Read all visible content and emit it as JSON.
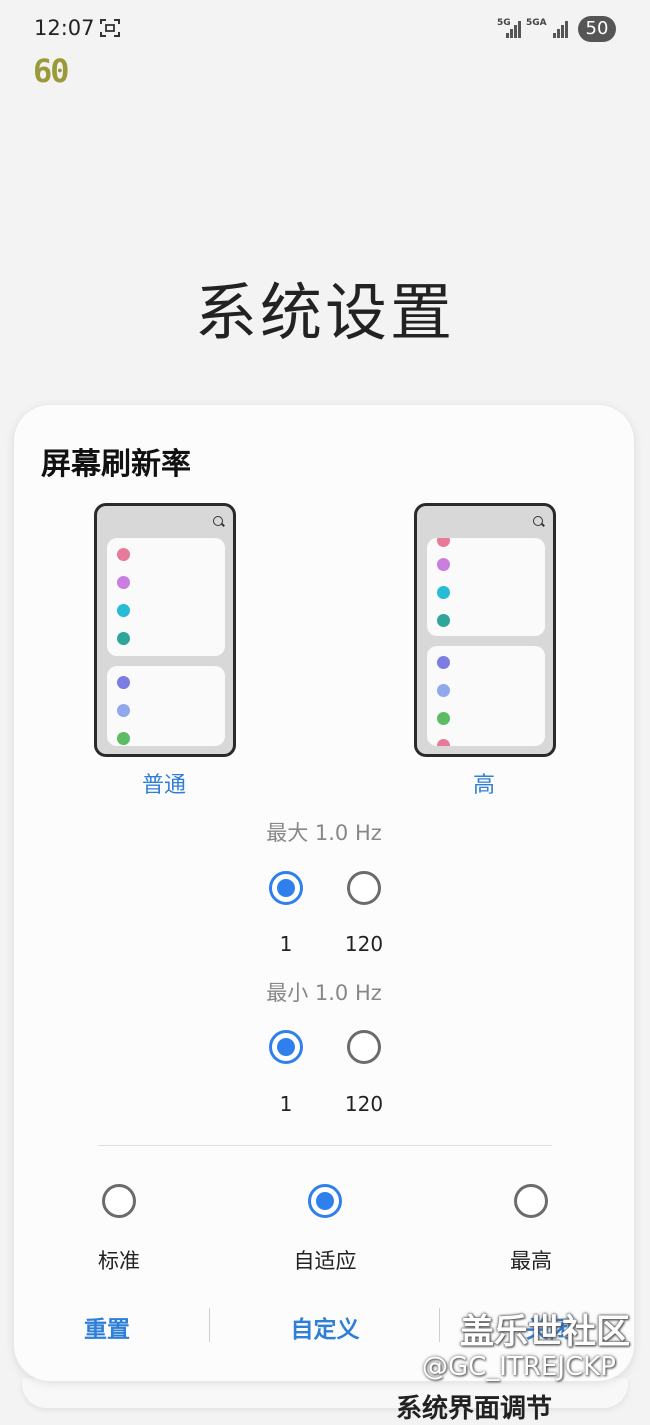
{
  "status_bar": {
    "time": "12:07",
    "fps": "60",
    "net1": "5G",
    "net2": "5GA",
    "battery": "50"
  },
  "page_title": "系统设置",
  "refresh_rate": {
    "title": "屏幕刷新率",
    "modes": [
      {
        "label": "普通"
      },
      {
        "label": "高"
      }
    ],
    "max": {
      "label": "最大 1.0 Hz",
      "options": [
        "1",
        "120"
      ],
      "selected": "1"
    },
    "min": {
      "label": "最小 1.0 Hz",
      "options": [
        "1",
        "120"
      ],
      "selected": "1"
    },
    "presets": [
      {
        "label": "标准",
        "selected": false
      },
      {
        "label": "自适应",
        "selected": true
      },
      {
        "label": "最高",
        "selected": false
      }
    ],
    "footer": {
      "reset": "重置",
      "custom": "自定义",
      "close": "关闭"
    },
    "accent_color": "#2f80ed"
  },
  "watermark": {
    "line1": "盖乐世社区",
    "line2": "@GC_ITREJCKP"
  },
  "next_section_peek": "系统界面调节"
}
